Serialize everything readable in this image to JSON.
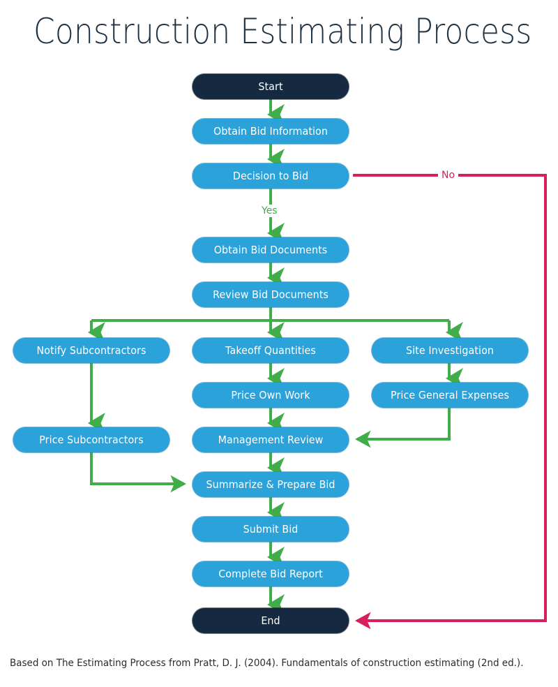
{
  "page": {
    "title": "Construction Estimating Process",
    "footer_note": "Based on The Estimating Process from Pratt, D. J. (2004). Fundamentals of construction estimating (2nd ed.).",
    "background_color": "#ffffff"
  },
  "theme": {
    "title_color": "#1d3144",
    "process_fill": "#2ba2d9",
    "terminator_fill": "#152a41",
    "node_text_color": "#ffffff",
    "flow_arrow_color": "#3fae49",
    "reject_arrow_color": "#d81f5e",
    "footer_text_color": "#2b2b2b"
  },
  "flowchart": {
    "type": "flowchart",
    "orientation": "top-to-bottom",
    "nodes": [
      {
        "id": "start",
        "label": "Start",
        "shape": "terminator",
        "column": "middle",
        "row": 1
      },
      {
        "id": "obtain-info",
        "label": "Obtain Bid Information",
        "shape": "process",
        "column": "middle",
        "row": 2
      },
      {
        "id": "decision",
        "label": "Decision to Bid",
        "shape": "process",
        "column": "middle",
        "row": 3
      },
      {
        "id": "obtain-docs",
        "label": "Obtain Bid Documents",
        "shape": "process",
        "column": "middle",
        "row": 4
      },
      {
        "id": "review-docs",
        "label": "Review Bid Documents",
        "shape": "process",
        "column": "middle",
        "row": 5
      },
      {
        "id": "notify-subs",
        "label": "Notify Subcontractors",
        "shape": "process",
        "column": "left",
        "row": 6
      },
      {
        "id": "takeoff",
        "label": "Takeoff Quantities",
        "shape": "process",
        "column": "middle",
        "row": 6
      },
      {
        "id": "site-invest",
        "label": "Site Investigation",
        "shape": "process",
        "column": "right",
        "row": 6
      },
      {
        "id": "price-own",
        "label": "Price Own Work",
        "shape": "process",
        "column": "middle",
        "row": 7
      },
      {
        "id": "price-general",
        "label": "Price General Expenses",
        "shape": "process",
        "column": "right",
        "row": 7
      },
      {
        "id": "price-subs",
        "label": "Price Subcontractors",
        "shape": "process",
        "column": "left",
        "row": 8
      },
      {
        "id": "mgmt-review",
        "label": "Management Review",
        "shape": "process",
        "column": "middle",
        "row": 8
      },
      {
        "id": "summarize",
        "label": "Summarize & Prepare Bid",
        "shape": "process",
        "column": "middle",
        "row": 9
      },
      {
        "id": "submit",
        "label": "Submit Bid",
        "shape": "process",
        "column": "middle",
        "row": 10
      },
      {
        "id": "complete",
        "label": "Complete Bid Report",
        "shape": "process",
        "column": "middle",
        "row": 11
      },
      {
        "id": "end",
        "label": "End",
        "shape": "terminator",
        "column": "middle",
        "row": 12
      }
    ],
    "edge_labels": {
      "yes": "Yes",
      "no": "No"
    },
    "edges": [
      {
        "from": "start",
        "to": "obtain-info",
        "label": "",
        "color": "#3fae49"
      },
      {
        "from": "obtain-info",
        "to": "decision",
        "label": "",
        "color": "#3fae49"
      },
      {
        "from": "decision",
        "to": "obtain-docs",
        "label": "Yes",
        "color": "#3fae49"
      },
      {
        "from": "decision",
        "to": "end",
        "label": "No",
        "color": "#d81f5e"
      },
      {
        "from": "obtain-docs",
        "to": "review-docs",
        "label": "",
        "color": "#3fae49"
      },
      {
        "from": "review-docs",
        "to": "notify-subs",
        "label": "",
        "color": "#3fae49"
      },
      {
        "from": "review-docs",
        "to": "takeoff",
        "label": "",
        "color": "#3fae49"
      },
      {
        "from": "review-docs",
        "to": "site-invest",
        "label": "",
        "color": "#3fae49"
      },
      {
        "from": "notify-subs",
        "to": "price-subs",
        "label": "",
        "color": "#3fae49"
      },
      {
        "from": "takeoff",
        "to": "price-own",
        "label": "",
        "color": "#3fae49"
      },
      {
        "from": "site-invest",
        "to": "price-general",
        "label": "",
        "color": "#3fae49"
      },
      {
        "from": "price-own",
        "to": "mgmt-review",
        "label": "",
        "color": "#3fae49"
      },
      {
        "from": "price-general",
        "to": "mgmt-review",
        "label": "",
        "color": "#3fae49"
      },
      {
        "from": "price-subs",
        "to": "summarize",
        "label": "",
        "color": "#3fae49"
      },
      {
        "from": "mgmt-review",
        "to": "summarize",
        "label": "",
        "color": "#3fae49"
      },
      {
        "from": "summarize",
        "to": "submit",
        "label": "",
        "color": "#3fae49"
      },
      {
        "from": "submit",
        "to": "complete",
        "label": "",
        "color": "#3fae49"
      },
      {
        "from": "complete",
        "to": "end",
        "label": "",
        "color": "#3fae49"
      }
    ]
  }
}
